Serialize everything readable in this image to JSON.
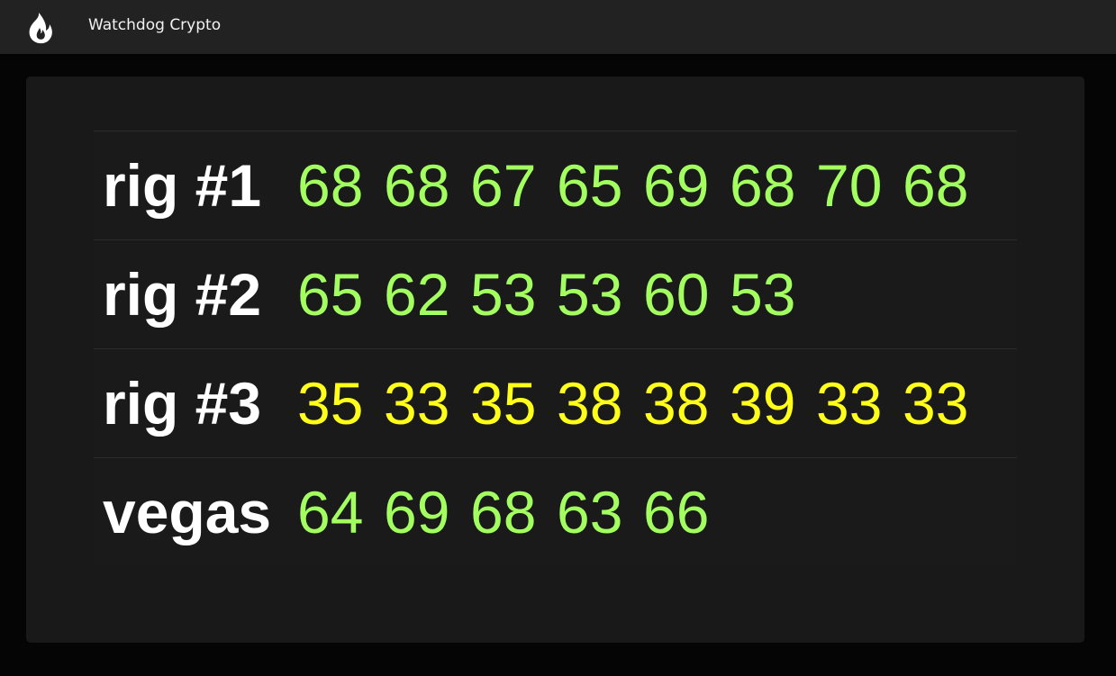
{
  "app": {
    "title": "Watchdog Crypto",
    "logo_icon": "flame-icon"
  },
  "colors": {
    "ok": "#a3ff60",
    "warn": "#ffff1a",
    "background": "#050505",
    "card": "#191919",
    "topbar": "#222222"
  },
  "rigs": [
    {
      "name": "rig #1",
      "status": "ok",
      "temps": [
        "68",
        "68",
        "67",
        "65",
        "69",
        "68",
        "70",
        "68"
      ]
    },
    {
      "name": "rig #2",
      "status": "ok",
      "temps": [
        "65",
        "62",
        "53",
        "53",
        "60",
        "53"
      ]
    },
    {
      "name": "rig #3",
      "status": "warn",
      "temps": [
        "35",
        "33",
        "35",
        "38",
        "38",
        "39",
        "33",
        "33"
      ]
    },
    {
      "name": "vegas",
      "status": "ok",
      "temps": [
        "64",
        "69",
        "68",
        "63",
        "66"
      ]
    }
  ]
}
